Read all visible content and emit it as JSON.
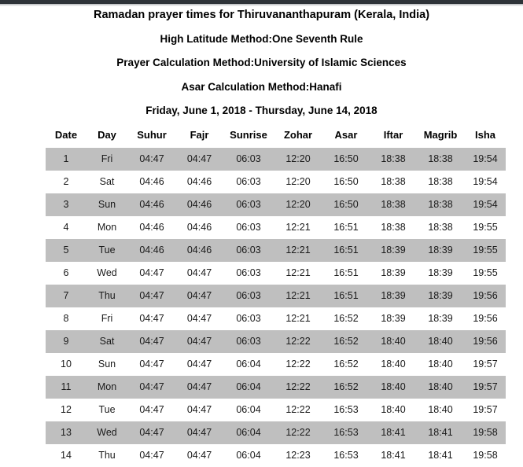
{
  "document": {
    "title": "Ramadan prayer times for Thiruvananthapuram (Kerala, India)",
    "high_latitude_method": "High Latitude Method:One Seventh Rule",
    "prayer_calculation_method": "Prayer Calculation Method:University of Islamic Sciences",
    "asar_calculation_method": "Asar Calculation Method:Hanafi",
    "date_range": "Friday, June 1, 2018 - Thursday, June 14, 2018"
  },
  "colors": {
    "topbar": "#2e3338",
    "row_shaded": "#bfbfbf",
    "row_plain": "#ffffff",
    "text": "#000000"
  },
  "table": {
    "columns": [
      "Date",
      "Day",
      "Suhur",
      "Fajr",
      "Sunrise",
      "Zohar",
      "Asar",
      "Iftar",
      "Magrib",
      "Isha"
    ],
    "rows": [
      {
        "date": "1",
        "day": "Fri",
        "suhur": "04:47",
        "fajr": "04:47",
        "sunrise": "06:03",
        "zohar": "12:20",
        "asar": "16:50",
        "iftar": "18:38",
        "magrib": "18:38",
        "isha": "19:54",
        "shaded": true
      },
      {
        "date": "2",
        "day": "Sat",
        "suhur": "04:46",
        "fajr": "04:46",
        "sunrise": "06:03",
        "zohar": "12:20",
        "asar": "16:50",
        "iftar": "18:38",
        "magrib": "18:38",
        "isha": "19:54",
        "shaded": false
      },
      {
        "date": "3",
        "day": "Sun",
        "suhur": "04:46",
        "fajr": "04:46",
        "sunrise": "06:03",
        "zohar": "12:20",
        "asar": "16:50",
        "iftar": "18:38",
        "magrib": "18:38",
        "isha": "19:54",
        "shaded": true
      },
      {
        "date": "4",
        "day": "Mon",
        "suhur": "04:46",
        "fajr": "04:46",
        "sunrise": "06:03",
        "zohar": "12:21",
        "asar": "16:51",
        "iftar": "18:38",
        "magrib": "18:38",
        "isha": "19:55",
        "shaded": false
      },
      {
        "date": "5",
        "day": "Tue",
        "suhur": "04:46",
        "fajr": "04:46",
        "sunrise": "06:03",
        "zohar": "12:21",
        "asar": "16:51",
        "iftar": "18:39",
        "magrib": "18:39",
        "isha": "19:55",
        "shaded": true
      },
      {
        "date": "6",
        "day": "Wed",
        "suhur": "04:47",
        "fajr": "04:47",
        "sunrise": "06:03",
        "zohar": "12:21",
        "asar": "16:51",
        "iftar": "18:39",
        "magrib": "18:39",
        "isha": "19:55",
        "shaded": false
      },
      {
        "date": "7",
        "day": "Thu",
        "suhur": "04:47",
        "fajr": "04:47",
        "sunrise": "06:03",
        "zohar": "12:21",
        "asar": "16:51",
        "iftar": "18:39",
        "magrib": "18:39",
        "isha": "19:56",
        "shaded": true
      },
      {
        "date": "8",
        "day": "Fri",
        "suhur": "04:47",
        "fajr": "04:47",
        "sunrise": "06:03",
        "zohar": "12:21",
        "asar": "16:52",
        "iftar": "18:39",
        "magrib": "18:39",
        "isha": "19:56",
        "shaded": false
      },
      {
        "date": "9",
        "day": "Sat",
        "suhur": "04:47",
        "fajr": "04:47",
        "sunrise": "06:03",
        "zohar": "12:22",
        "asar": "16:52",
        "iftar": "18:40",
        "magrib": "18:40",
        "isha": "19:56",
        "shaded": true
      },
      {
        "date": "10",
        "day": "Sun",
        "suhur": "04:47",
        "fajr": "04:47",
        "sunrise": "06:04",
        "zohar": "12:22",
        "asar": "16:52",
        "iftar": "18:40",
        "magrib": "18:40",
        "isha": "19:57",
        "shaded": false
      },
      {
        "date": "11",
        "day": "Mon",
        "suhur": "04:47",
        "fajr": "04:47",
        "sunrise": "06:04",
        "zohar": "12:22",
        "asar": "16:52",
        "iftar": "18:40",
        "magrib": "18:40",
        "isha": "19:57",
        "shaded": true
      },
      {
        "date": "12",
        "day": "Tue",
        "suhur": "04:47",
        "fajr": "04:47",
        "sunrise": "06:04",
        "zohar": "12:22",
        "asar": "16:53",
        "iftar": "18:40",
        "magrib": "18:40",
        "isha": "19:57",
        "shaded": false
      },
      {
        "date": "13",
        "day": "Wed",
        "suhur": "04:47",
        "fajr": "04:47",
        "sunrise": "06:04",
        "zohar": "12:22",
        "asar": "16:53",
        "iftar": "18:41",
        "magrib": "18:41",
        "isha": "19:58",
        "shaded": true
      },
      {
        "date": "14",
        "day": "Thu",
        "suhur": "04:47",
        "fajr": "04:47",
        "sunrise": "06:04",
        "zohar": "12:23",
        "asar": "16:53",
        "iftar": "18:41",
        "magrib": "18:41",
        "isha": "19:58",
        "shaded": false
      }
    ]
  }
}
